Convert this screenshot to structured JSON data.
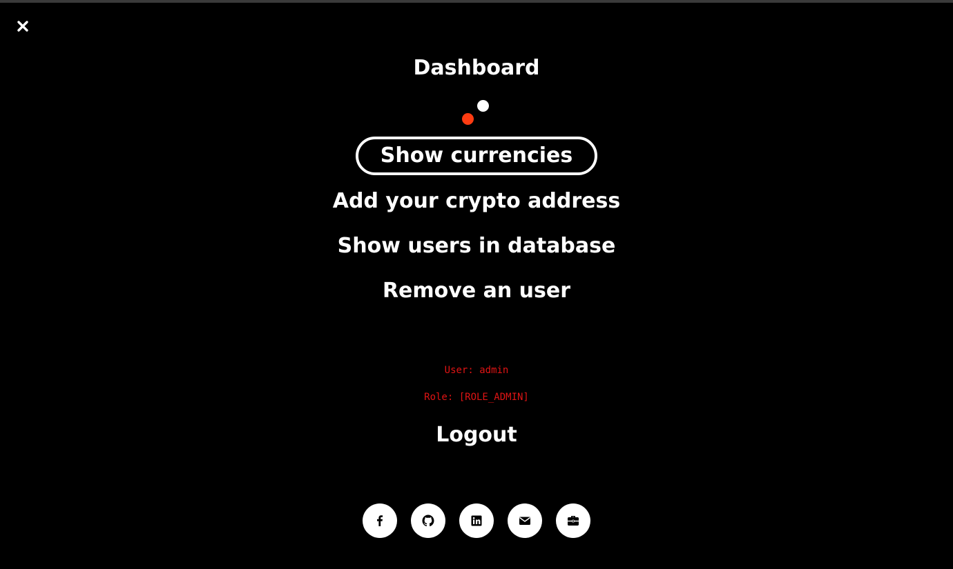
{
  "window": {
    "close_icon": "close-icon"
  },
  "menu": {
    "title": "Dashboard",
    "items": [
      {
        "label": "Show currencies",
        "active": true
      },
      {
        "label": "Add your crypto address",
        "active": false
      },
      {
        "label": "Show users in database",
        "active": false
      },
      {
        "label": "Remove an user",
        "active": false
      }
    ],
    "logout_label": "Logout"
  },
  "user_info": {
    "user_line": "User: admin",
    "role_line": "Role: [ROLE_ADMIN]"
  },
  "social": [
    {
      "icon": "facebook-icon"
    },
    {
      "icon": "github-icon"
    },
    {
      "icon": "linkedin-icon"
    },
    {
      "icon": "email-icon"
    },
    {
      "icon": "briefcase-icon"
    }
  ],
  "colors": {
    "background": "#000000",
    "text": "#ffffff",
    "accent_dot": "#ff3c12",
    "info_text": "#e01414"
  }
}
